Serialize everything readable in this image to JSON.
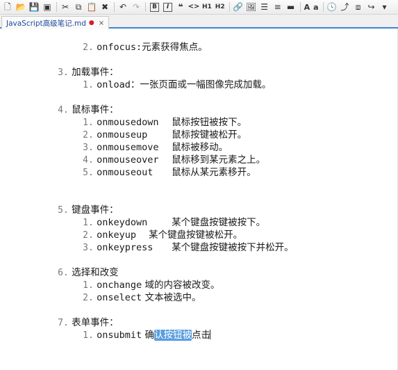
{
  "toolbar": {
    "icons": [
      "new-file-icon",
      "open-folder-icon",
      "save-icon",
      "save-all-icon",
      "cut-icon",
      "copy-icon",
      "paste-icon",
      "delete-icon",
      "undo-icon",
      "redo-icon",
      "bold-icon",
      "italic-icon",
      "quote-icon",
      "code-icon",
      "heading1-icon",
      "heading2-icon",
      "link-icon",
      "image-icon",
      "unordered-list-icon",
      "ordered-list-icon",
      "horizontal-rule-icon",
      "uppercase-icon",
      "lowercase-icon",
      "timestamp-icon",
      "toc-icon",
      "preview-icon",
      "export-icon",
      "more-icon"
    ],
    "bold": "B",
    "italic": "I",
    "h1": "H1",
    "h2": "H2",
    "upper_a": "A",
    "lower_a": "a"
  },
  "tab": {
    "title": "JavaScript高级笔记.md",
    "modified": "●",
    "close": "×"
  },
  "lines": {
    "l0": {
      "num": "2.",
      "text": "onfocus:元素获得焦点。"
    },
    "s3": {
      "num": "3.",
      "text": "加载事件："
    },
    "s3_1": {
      "num": "1.",
      "code": "onload",
      "text": "：一张页面或一幅图像完成加载。"
    },
    "s4": {
      "num": "4.",
      "text": "鼠标事件："
    },
    "s4_1": {
      "num": "1.",
      "code": "onmousedown",
      "text": "鼠标按钮被按下。"
    },
    "s4_2": {
      "num": "2.",
      "code": "onmouseup",
      "text": "鼠标按键被松开。"
    },
    "s4_3": {
      "num": "3.",
      "code": "onmousemove",
      "text": "鼠标被移动。"
    },
    "s4_4": {
      "num": "4.",
      "code": "onmouseover",
      "text": "鼠标移到某元素之上。"
    },
    "s4_5": {
      "num": "5.",
      "code": "onmouseout",
      "text": "鼠标从某元素移开。"
    },
    "s5": {
      "num": "5.",
      "text": "键盘事件："
    },
    "s5_1": {
      "num": "1.",
      "code": "onkeydown",
      "text": "某个键盘按键被按下。"
    },
    "s5_2": {
      "num": "2.",
      "code": "onkeyup",
      "text": "某个键盘按键被松开。"
    },
    "s5_3": {
      "num": "3.",
      "code": "onkeypress",
      "text": "某个键盘按键被按下并松开。"
    },
    "s6": {
      "num": "6.",
      "text": "选择和改变"
    },
    "s6_1": {
      "num": "1.",
      "code": "onchange",
      "text": "域的内容被改变。"
    },
    "s6_2": {
      "num": "2.",
      "code": "onselect",
      "text": "文本被选中。"
    },
    "s7": {
      "num": "7.",
      "text": "表单事件："
    },
    "s7_1": {
      "num": "1.",
      "code": "onsubmit",
      "pre": "确",
      "selected": "认按钮被",
      "post": "点击"
    }
  }
}
